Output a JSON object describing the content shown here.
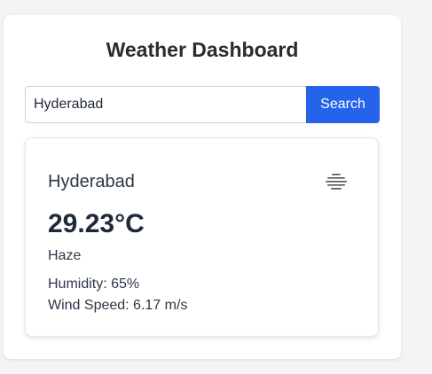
{
  "app": {
    "title": "Weather Dashboard"
  },
  "search": {
    "value": "Hyderabad",
    "button_label": "Search"
  },
  "weather": {
    "city": "Hyderabad",
    "temperature": "29.23°C",
    "condition": "Haze",
    "condition_icon": "haze-icon",
    "humidity": "Humidity: 65%",
    "wind_speed": "Wind Speed: 6.17 m/s"
  },
  "colors": {
    "accent": "#2563eb",
    "background": "#f3f4f6",
    "card": "#ffffff"
  }
}
